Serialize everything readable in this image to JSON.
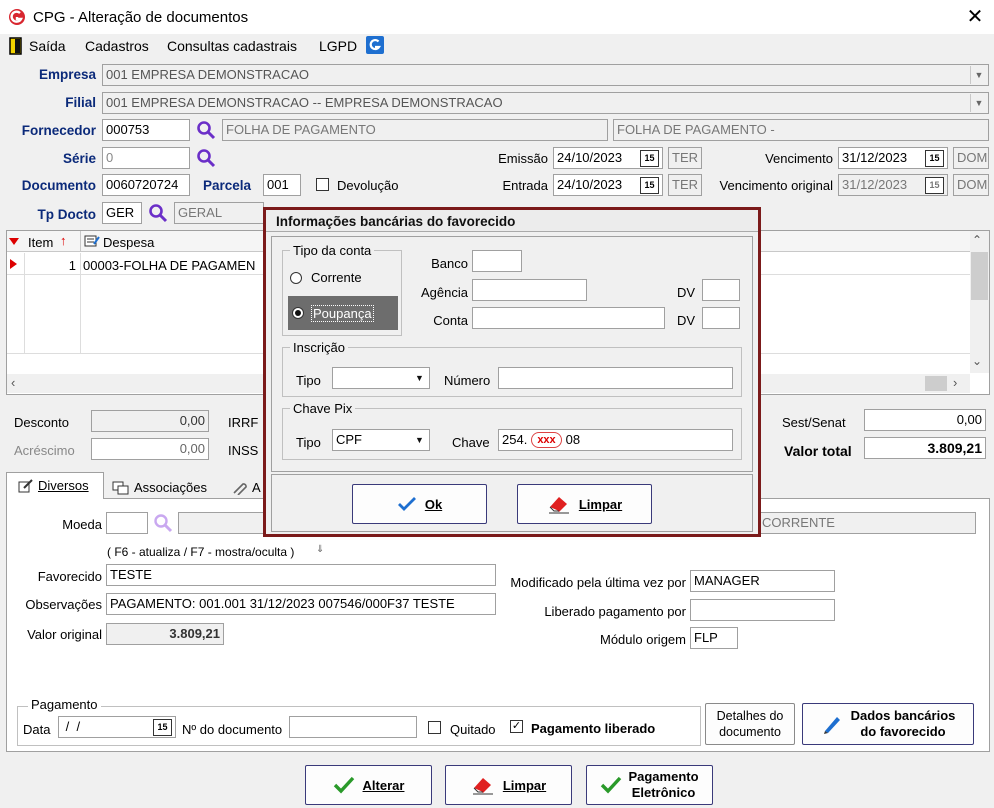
{
  "window": {
    "title": "CPG - Alteração de documentos",
    "close_glyph": "✕"
  },
  "menu": [
    "Saída",
    "Cadastros",
    "Consultas cadastrais",
    "LGPD"
  ],
  "header": {
    "empresa_label": "Empresa",
    "empresa_value": "001 EMPRESA DEMONSTRACAO",
    "filial_label": "Filial",
    "filial_value": "001 EMPRESA DEMONSTRACAO -- EMPRESA DEMONSTRACAO",
    "fornecedor_label": "Fornecedor",
    "fornecedor_code": "000753",
    "fornecedor_name": "FOLHA DE PAGAMENTO",
    "fornecedor_name2": "FOLHA DE PAGAMENTO -",
    "serie_label": "Série",
    "serie_value": "0",
    "documento_label": "Documento",
    "documento_value": "0060720724",
    "parcela_label": "Parcela",
    "parcela_value": "001",
    "devolucao_label": "Devolução",
    "emissao_label": "Emissão",
    "emissao_value": "24/10/2023",
    "emissao_day": "TER",
    "entrada_label": "Entrada",
    "entrada_value": "24/10/2023",
    "entrada_day": "TER",
    "vencimento_label": "Vencimento",
    "vencimento_value": "31/12/2023",
    "vencimento_day": "DOM",
    "venc_orig_label": "Vencimento original",
    "venc_orig_value": "31/12/2023",
    "venc_orig_day": "DOM",
    "tpdocto_label": "Tp Docto",
    "tpdocto_code": "GER",
    "tpdocto_name": "GERAL",
    "cal_label": "15"
  },
  "grid": {
    "col_item": "Item",
    "col_despesa": "Despesa",
    "rows": [
      {
        "item": "1",
        "despesa": "00003-FOLHA DE PAGAMEN"
      }
    ]
  },
  "totals": {
    "desconto_label": "Desconto",
    "desconto_value": "0,00",
    "acrescimo_label": "Acréscimo",
    "acrescimo_value": "0,00",
    "irrf_label": "IRRF",
    "inss_label": "INSS",
    "sest_label": "Sest/Senat",
    "sest_value": "0,00",
    "valor_total_label": "Valor total",
    "valor_total_value": "3.809,21"
  },
  "tabs": [
    "Diversos",
    "Associações",
    "A"
  ],
  "diversos": {
    "moeda_label": "Moeda",
    "moeda_value": "",
    "corrente_text": "CORRENTE",
    "hint": "( F6 - atualiza / F7 - mostra/oculta )",
    "favorecido_label": "Favorecido",
    "favorecido_value": "TESTE",
    "obs_label": "Observações",
    "obs_value": "PAGAMENTO: 001.001 31/12/2023 007546/000F37 TESTE",
    "valor_original_label": "Valor original",
    "valor_original_value": "3.809,21",
    "modificado_label": "Modificado pela última vez por",
    "modificado_value": "MANAGER",
    "liberado_label": "Liberado pagamento por",
    "liberado_value": "",
    "modulo_label": "Módulo origem",
    "modulo_value": "FLP"
  },
  "pagamento": {
    "group_label": "Pagamento",
    "data_label": "Data",
    "data_value": " /  /",
    "ndoc_label": "Nº do documento",
    "ndoc_value": "",
    "quitado_label": "Quitado",
    "liberado_label": "Pagamento liberado",
    "detalhes_btn_l1": "Detalhes do",
    "detalhes_btn_l2": "documento",
    "dados_btn_l1": "Dados bancários",
    "dados_btn_l2": "do favorecido"
  },
  "footer": {
    "alterar": "Alterar",
    "limpar": "Limpar",
    "pag_l1": "Pagamento",
    "pag_l2": "Eletrônico"
  },
  "modal": {
    "title": "Informações bancárias do favorecido",
    "tipo_conta_label": "Tipo da conta",
    "corrente": "Corrente",
    "poupanca": "Poupança",
    "banco_label": "Banco",
    "banco_value": "",
    "agencia_label": "Agência",
    "agencia_value": "",
    "conta_label": "Conta",
    "conta_value": "",
    "dv_label": "DV",
    "inscricao_label": "Inscrição",
    "tipo_label": "Tipo",
    "tipo_value": "",
    "numero_label": "Número",
    "numero_value": "",
    "chave_pix_label": "Chave Pix",
    "pix_tipo_value": "CPF",
    "chave_label": "Chave",
    "chave_prefix": "254.",
    "chave_redacted": "xxx",
    "chave_suffix": "08",
    "ok_label": "Ok",
    "limpar_label": "Limpar"
  },
  "colors": {
    "label_blue": "#0b2a7a",
    "modal_border": "#7b1a1a",
    "magnifier": "#6b2fc8",
    "check_green": "#2a9a2a",
    "accent_blue": "#1e6fd0"
  }
}
